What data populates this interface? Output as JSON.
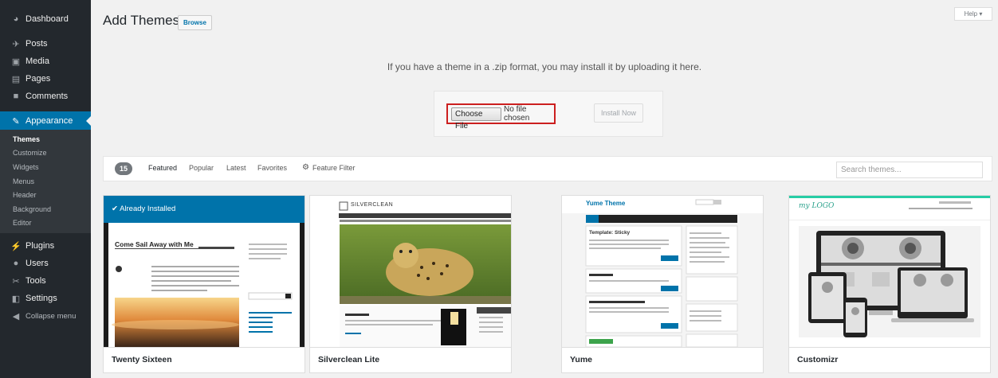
{
  "sidebar": {
    "items": [
      {
        "label": "Dashboard",
        "icon": "dashboard-icon"
      },
      {
        "label": "Posts",
        "icon": "pin-icon"
      },
      {
        "label": "Media",
        "icon": "media-icon"
      },
      {
        "label": "Pages",
        "icon": "pages-icon"
      },
      {
        "label": "Comments",
        "icon": "comments-icon"
      },
      {
        "label": "Appearance",
        "icon": "appearance-icon"
      },
      {
        "label": "Plugins",
        "icon": "plugins-icon"
      },
      {
        "label": "Users",
        "icon": "users-icon"
      },
      {
        "label": "Tools",
        "icon": "tools-icon"
      },
      {
        "label": "Settings",
        "icon": "settings-icon"
      },
      {
        "label": "Collapse menu",
        "icon": "collapse-icon"
      }
    ],
    "submenu": [
      "Themes",
      "Customize",
      "Widgets",
      "Menus",
      "Header",
      "Background",
      "Editor"
    ]
  },
  "header": {
    "title": "Add Themes",
    "browse_label": "Browse",
    "help_label": "Help ▾"
  },
  "upload": {
    "message": "If you have a theme in a .zip format, you may install it by uploading it here.",
    "choose_label": "Choose File",
    "file_status": "No file chosen",
    "install_label": "Install Now"
  },
  "filter": {
    "count": "15",
    "tabs": [
      "Featured",
      "Popular",
      "Latest",
      "Favorites"
    ],
    "feature_filter": "Feature Filter",
    "search_placeholder": "Search themes..."
  },
  "themes": [
    {
      "name": "Twenty Sixteen",
      "installed_label": "✔  Already Installed",
      "preview_heading": "Come Sail Away with Me"
    },
    {
      "name": "Silverclean Lite",
      "preview_logo": "SILVERCLEAN"
    },
    {
      "name": "Yume",
      "preview_logo": "Yume Theme",
      "preview_heading": "Template: Sticky"
    },
    {
      "name": "Customizr",
      "preview_logo": "my LOGO"
    }
  ],
  "colors": {
    "accent": "#0073aa",
    "sidebar": "#23282d",
    "highlight": "#cc1f1f"
  }
}
